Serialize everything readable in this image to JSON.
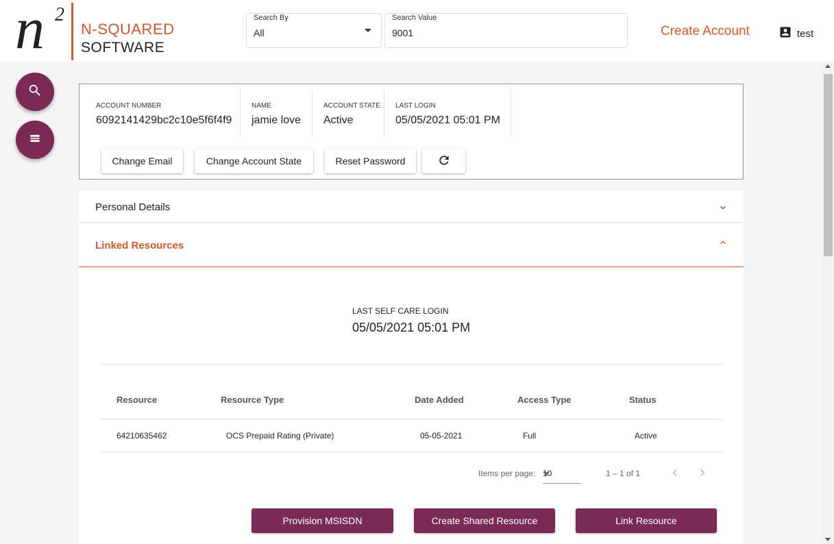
{
  "brand": {
    "logo_letter": "n",
    "logo_superscript": "2",
    "line1": "N-SQUARED",
    "line2": "SOFTWARE"
  },
  "search": {
    "by_label": "Search By",
    "by_value": "All",
    "value_label": "Search Value",
    "value": "9001"
  },
  "header": {
    "create_account": "Create Account",
    "username": "test"
  },
  "account": {
    "number_label": "ACCOUNT NUMBER",
    "number": "6092141429bc2c10e5f6f4f9",
    "name_label": "NAME",
    "name": "jamie love",
    "state_label": "ACCOUNT STATE",
    "state": "Active",
    "login_label": "LAST LOGIN",
    "login": "05/05/2021 05:01 PM",
    "actions": {
      "change_email": "Change Email",
      "change_state": "Change Account State",
      "reset_password": "Reset Password"
    }
  },
  "panels": {
    "personal_details": "Personal Details",
    "linked_resources": "Linked Resources"
  },
  "linked": {
    "last_login_label": "LAST SELF CARE LOGIN",
    "last_login_value": "05/05/2021 05:01 PM",
    "columns": [
      "Resource",
      "Resource Type",
      "Date Added",
      "Access Type",
      "Status"
    ],
    "rows": [
      [
        "64210635462",
        "OCS Prepaid Rating (Private)",
        "05-05-2021",
        "Full",
        "Active"
      ]
    ],
    "paginator": {
      "items_per_page_label": "Items per page:",
      "items_per_page": "10",
      "range": "1 – 1 of 1"
    },
    "buttons": {
      "provision": "Provision MSISDN",
      "create_shared": "Create Shared Resource",
      "link": "Link Resource"
    }
  },
  "colors": {
    "brand_orange": "#d4562a",
    "primary_purple": "#7b2a55"
  }
}
